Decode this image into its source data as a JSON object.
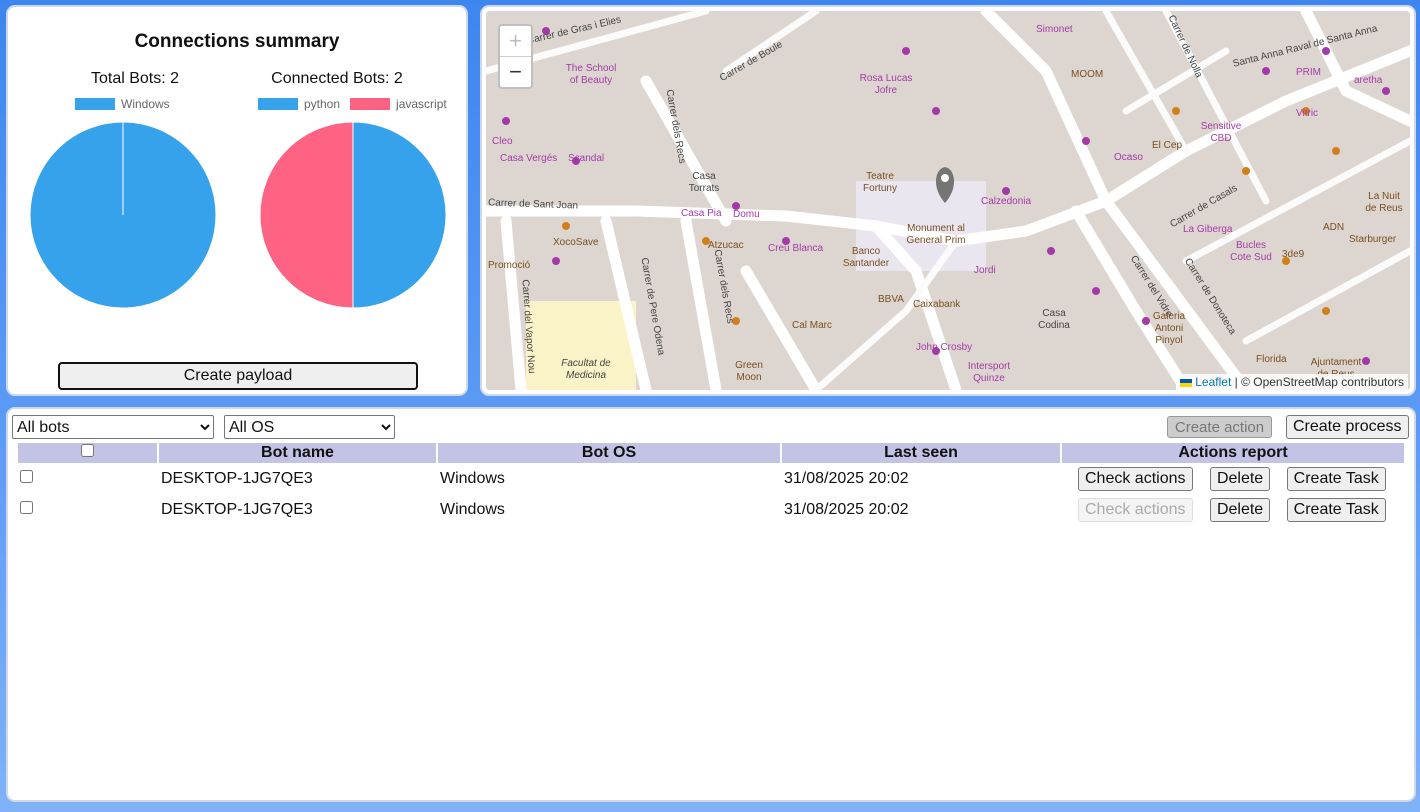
{
  "summary": {
    "title": "Connections summary",
    "total_label": "Total Bots: 2",
    "connected_label": "Connected Bots: 2",
    "chart_total": {
      "legend": "Windows"
    },
    "chart_connected": {
      "legend_a": "python",
      "legend_b": "javascript"
    },
    "create_payload": "Create payload"
  },
  "chart_data": [
    {
      "type": "pie",
      "title": "Total Bots: 2",
      "categories": [
        "Windows"
      ],
      "values": [
        2
      ],
      "colors": [
        "#36a2eb"
      ],
      "legend_position": "top"
    },
    {
      "type": "pie",
      "title": "Connected Bots: 2",
      "categories": [
        "python",
        "javascript"
      ],
      "values": [
        1,
        1
      ],
      "colors": [
        "#36a2eb",
        "#ff6384"
      ],
      "legend_position": "top"
    }
  ],
  "map": {
    "zoom_in": "+",
    "zoom_out": "−",
    "attribution_link": "Leaflet",
    "attribution_text": "| © OpenStreetMap contributors",
    "labels": {
      "l1": "Carrer de Gras i Elies",
      "l2": "Carrer de Boule",
      "l3": "The School of Beauty",
      "l4": "Carrer dels Recs",
      "l5": "Casa Torrats",
      "l6": "Carrer de Sant Joan",
      "l7": "Casa Pia",
      "l8": "Domu",
      "l9": "XocoSave",
      "l10": "Atzucac",
      "l11": "Creu Blanca",
      "l12": "Carrer de Pere Odena",
      "l13": "Carrer dels Recs",
      "l14": "Carrer del Vapor Nou",
      "l15": "Facultat de Medicina",
      "l16": "Teatre Fortuny",
      "l17": "Monument al General Prim",
      "l18": "Banco Santander",
      "l19": "BBVA",
      "l20": "Caixabank",
      "l21": "Jordi",
      "l22": "Calzedonia",
      "l23": "Cal Marc",
      "l24": "Green Moon",
      "l25": "John Crosby",
      "l26": "Intersport Quinze",
      "l27": "Casa Codina",
      "l28": "Carrer del Vidre",
      "l29": "Carrer de Donoteca",
      "l30": "Carrer de Casals",
      "l31": "La Giberga",
      "l32": "Bucles Cote Sud",
      "l33": "Galeria Antoni Pinyol",
      "l34": "Sensitive CBD",
      "l35": "El Cep",
      "l36": "Ocaso",
      "l37": "Simonet",
      "l38": "MOOM",
      "l39": "Carrer de Nolla",
      "l40": "Santa Anna Raval de Santa Anna",
      "l41": "PRIM",
      "l42": "aretha",
      "l43": "Vitric",
      "l44": "La Nuit de Reus",
      "l45": "ADN",
      "l46": "Starburger",
      "l47": "3de9",
      "l48": "Florida",
      "l49": "Ajuntament de Reus",
      "l50": "Rosa Lucas Jofre",
      "l51": "Casa Vergés",
      "l52": "Scandal",
      "l53": "Cleo",
      "l54": "Promoció"
    }
  },
  "bots": {
    "filter_bots": {
      "value": "All bots",
      "options": [
        "All bots"
      ]
    },
    "filter_os": {
      "value": "All OS",
      "options": [
        "All OS"
      ]
    },
    "create_action": "Create action",
    "create_process": "Create process",
    "columns": [
      "Bot name",
      "Bot OS",
      "Last seen",
      "Actions report"
    ],
    "rows": [
      {
        "name": "DESKTOP-1JG7QE3",
        "os": "Windows",
        "last_seen": "31/08/2025 20:02",
        "check": "Check actions",
        "delete": "Delete",
        "task": "Create Task"
      },
      {
        "name": "DESKTOP-1JG7QE3",
        "os": "Windows",
        "last_seen": "31/08/2025 20:02",
        "check": "Check actions",
        "delete": "Delete",
        "task": "Create Task"
      }
    ]
  }
}
